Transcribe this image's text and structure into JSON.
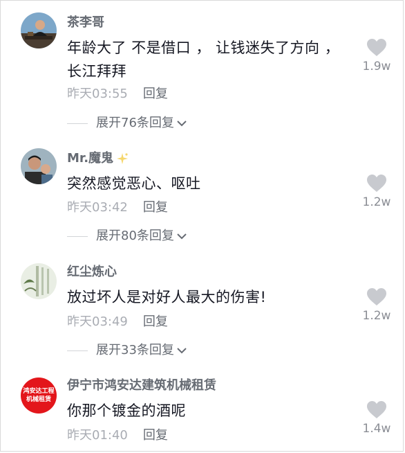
{
  "comments": [
    {
      "username": "茶李哥",
      "text": "年龄大了 不是借口 ， 让钱迷失了方向 ， 长江拜拜",
      "time": "昨天03:55",
      "reply_label": "回复",
      "likes": "1.9w",
      "expand_label": "展开76条回复",
      "avatar": "avatar-man-tea"
    },
    {
      "username": "Mr.魔鬼",
      "text": "突然感觉恶心、呕吐",
      "time": "昨天03:42",
      "reply_label": "回复",
      "likes": "1.2w",
      "expand_label": "展开80条回复",
      "avatar": "avatar-man-child"
    },
    {
      "username": "红尘炼心",
      "text": "放过坏人是对好人最大的伤害!",
      "time": "昨天03:49",
      "reply_label": "回复",
      "likes": "1.2w",
      "expand_label": "展开33条回复",
      "avatar": "avatar-calligraphy"
    },
    {
      "username": "伊宁市鸿安达建筑机械租赁",
      "text": "你那个镀金的酒呢",
      "time": "昨天01:40",
      "reply_label": "回复",
      "likes": "1.4w",
      "avatar": "avatar-red-logo",
      "avatar_text_1": "鸿安达工程",
      "avatar_text_2": "机械租赁"
    }
  ],
  "colors": {
    "username": "#666b73",
    "text": "#161823",
    "time": "#a9acb3",
    "heart": "#c8cacf",
    "logo_red": "#e3161b"
  }
}
